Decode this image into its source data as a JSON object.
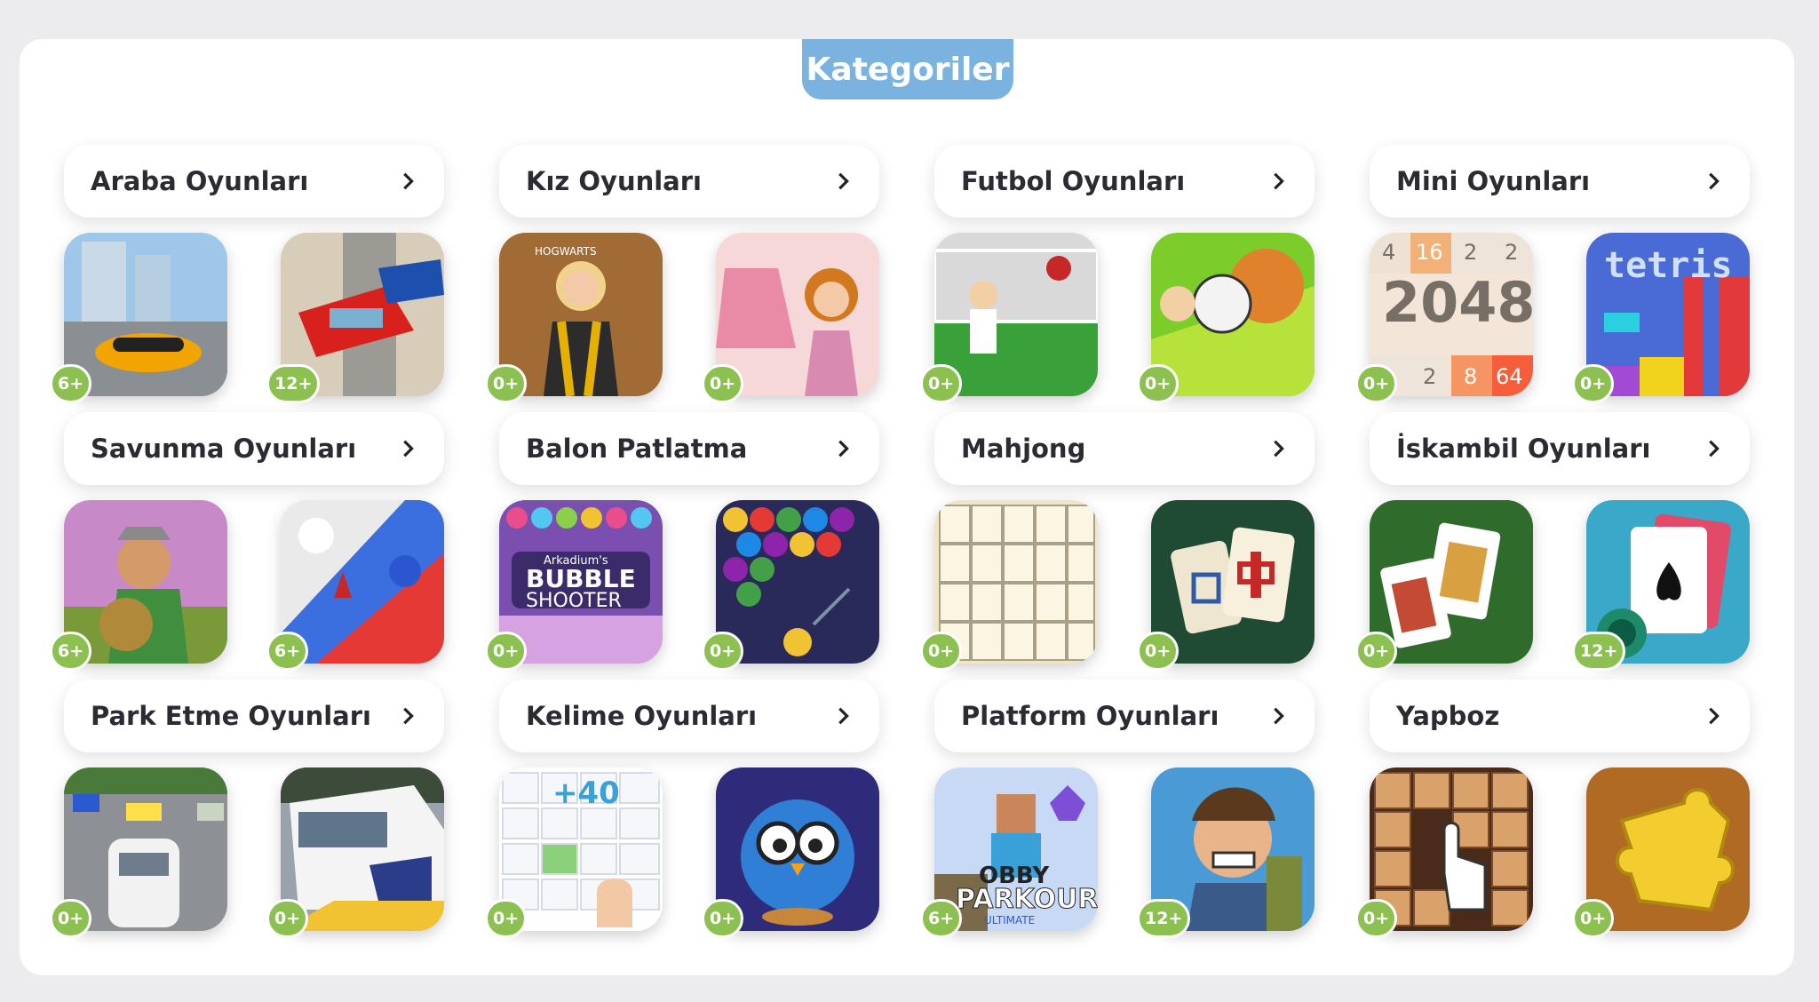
{
  "page": {
    "title": "Kategoriler"
  },
  "categories": [
    {
      "label": "Araba Oyunları",
      "games": [
        {
          "age": "6+"
        },
        {
          "age": "12+"
        }
      ]
    },
    {
      "label": "Kız Oyunları",
      "games": [
        {
          "age": "0+",
          "caption": "HOGWARTS"
        },
        {
          "age": "0+"
        }
      ]
    },
    {
      "label": "Futbol Oyunları",
      "games": [
        {
          "age": "0+"
        },
        {
          "age": "0+"
        }
      ]
    },
    {
      "label": "Mini Oyunları",
      "games": [
        {
          "age": "0+",
          "caption": "2048",
          "cells": [
            "4",
            "16",
            "2",
            "2",
            "2",
            "8",
            "64"
          ]
        },
        {
          "age": "0+",
          "caption": "tetris"
        }
      ]
    },
    {
      "label": "Savunma Oyunları",
      "games": [
        {
          "age": "6+"
        },
        {
          "age": "6+"
        }
      ]
    },
    {
      "label": "Balon Patlatma",
      "games": [
        {
          "age": "0+",
          "caption": "Arkadium's",
          "caption2": "BUBBLE",
          "caption3": "SHOOTER"
        },
        {
          "age": "0+"
        }
      ]
    },
    {
      "label": "Mahjong",
      "games": [
        {
          "age": "0+"
        },
        {
          "age": "0+"
        }
      ]
    },
    {
      "label": "İskambil Oyunları",
      "games": [
        {
          "age": "0+"
        },
        {
          "age": "12+"
        }
      ]
    },
    {
      "label": "Park Etme Oyunları",
      "games": [
        {
          "age": "0+"
        },
        {
          "age": "0+"
        }
      ]
    },
    {
      "label": "Kelime Oyunları",
      "games": [
        {
          "age": "0+",
          "caption": "+40"
        },
        {
          "age": "0+"
        }
      ]
    },
    {
      "label": "Platform Oyunları",
      "games": [
        {
          "age": "6+",
          "caption": "OBBY",
          "caption2": "PARKOUR",
          "caption3": "ULTIMATE"
        },
        {
          "age": "12+"
        }
      ]
    },
    {
      "label": "Yapboz",
      "games": [
        {
          "age": "0+"
        },
        {
          "age": "0+"
        }
      ]
    }
  ],
  "colors": {
    "accent": "#7ab3e0",
    "age_badge": "#8cc152",
    "icon": "chevron-right-icon"
  }
}
